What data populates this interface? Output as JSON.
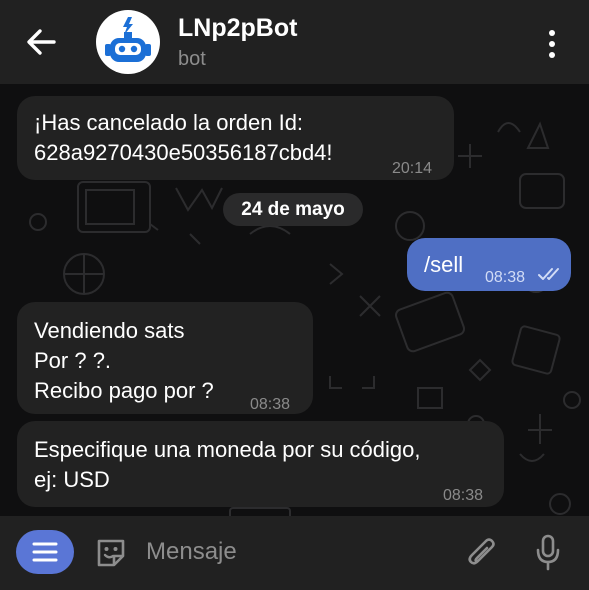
{
  "header": {
    "title": "LNp2pBot",
    "subtitle": "bot",
    "back_icon": "arrow-left-icon",
    "menu_icon": "more-vertical-icon",
    "avatar_icon": "robot-lightning-icon",
    "colors": {
      "background": "#212121",
      "avatar_primary": "#1b6fd6"
    }
  },
  "chat": {
    "date_separator": "24 de mayo",
    "messages": [
      {
        "direction": "incoming",
        "lines": [
          "¡Has cancelado la orden Id:",
          "628a9270430e50356187cbd4!"
        ],
        "time": "20:14"
      },
      {
        "direction": "outgoing",
        "lines": [
          "/sell"
        ],
        "time": "08:38",
        "status": "read"
      },
      {
        "direction": "incoming",
        "lines": [
          "Vendiendo sats",
          "Por ? ?.",
          "Recibo pago por ?"
        ],
        "time": "08:38"
      },
      {
        "direction": "incoming",
        "lines": [
          "Especifique una moneda por su código,",
          "ej: USD"
        ],
        "time": "08:38"
      }
    ],
    "colors": {
      "incoming_bubble": "#222222",
      "outgoing_bubble": "#4f6fc4"
    }
  },
  "input": {
    "placeholder": "Mensaje",
    "menu_icon": "hamburger-icon",
    "sticker_icon": "sticker-icon",
    "attach_icon": "paperclip-icon",
    "mic_icon": "microphone-icon",
    "colors": {
      "menu_button": "#5a76d6"
    }
  }
}
